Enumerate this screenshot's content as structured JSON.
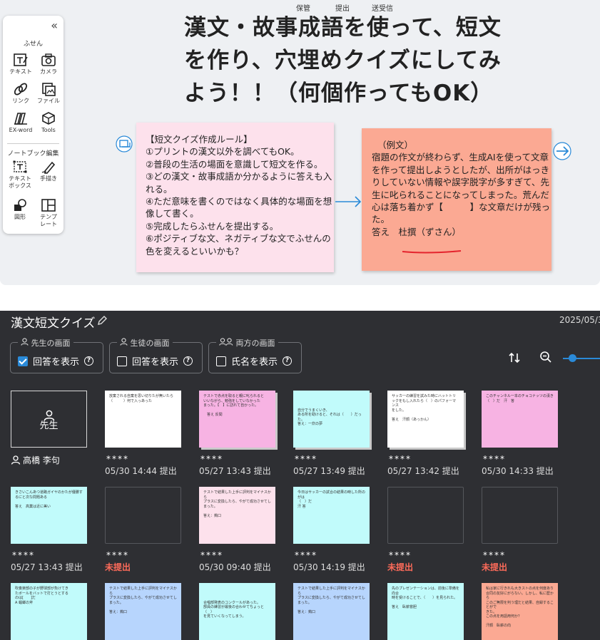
{
  "top_labels": [
    "保管",
    "提出",
    "送受信"
  ],
  "toolbar": {
    "section1": "ふせん",
    "section2": "ノートブック編集",
    "tools1": [
      {
        "label": "テキスト",
        "icon": "text-note-icon"
      },
      {
        "label": "カメラ",
        "icon": "camera-icon"
      },
      {
        "label": "リンク",
        "icon": "link-icon"
      },
      {
        "label": "ファイル",
        "icon": "file-icon"
      },
      {
        "label": "EX-word",
        "icon": "ex-word-icon"
      },
      {
        "label": "Tools",
        "icon": "tools-icon"
      }
    ],
    "tools2": [
      {
        "label": "テキスト\nボックス",
        "icon": "text-box-icon"
      },
      {
        "label": "手描き",
        "icon": "pen-icon"
      },
      {
        "label": "図形",
        "icon": "shape-icon"
      },
      {
        "label": "テンプ\nレート",
        "icon": "template-icon"
      }
    ]
  },
  "board": {
    "title": "漢文・故事成語を使って、短文を作り、穴埋めクイズにしてみよう！！（何個作ってもOK）",
    "rules_note": "【短文クイズ作成ルール】\n①プリントの漢文以外を調べてもOK。\n②普段の生活の場面を意識して短文を作る。\n③どの漢文・故事成語か分かるように答えも入れる。\n④ただ意味を書くのではなく具体的な場面を想像して書く。\n⑤完成したらふせんを提出する。\n⑥ポジティブな文、ネガティブな文でふせんの色を変えるといいかも？",
    "example_head": "（例文）",
    "example_body": "宿題の作文が終わらず、生成AIを使って文章を作って提出しようとしたが、出所がはっきりしていない情報や誤字脱字が多すぎて、先生に叱られることになってしまった。荒んだ心は落ち着かず【　　　】な文章だけが残った。\n答え　杜撰（ずさん）"
  },
  "panel": {
    "title": "漢文短文クイズ",
    "date": "2025/05/3",
    "views": [
      {
        "legend": "先生の画面",
        "label": "回答を表示",
        "checked": true
      },
      {
        "legend": "生徒の画面",
        "label": "回答を表示",
        "checked": false
      },
      {
        "legend": "両方の画面",
        "label": "氏名を表示",
        "checked": false
      }
    ],
    "teacher": {
      "label": "先生",
      "name": "高橋 李句"
    },
    "cards": [
      {
        "color": "#ffffff",
        "stack": false,
        "text": "放棄される自棄を思い切りたが無いたら\n（　　　）何で入っあった",
        "masked": "****",
        "status": "05/30 14:44 提出",
        "missing": false
      },
      {
        "color": "#f7b3e3",
        "stack": true,
        "text": "テストで赤点を取ると親に叱られると\nいいながら、勉強をしていなかった\nまった。【　】に訪れて自かった。\n\n　答え 反間",
        "masked": "****",
        "status": "05/27 13:43 提出",
        "missing": false
      },
      {
        "color": "#c1fbfb",
        "stack": true,
        "text": "\n\n\n自分でうまくいき、\nある所を助けると、それは（　　）だった。\n答え：一炊の夢",
        "masked": "****",
        "status": "05/27 13:49 提出",
        "missing": false
      },
      {
        "color": "#ffffff",
        "stack": true,
        "text": "サッカーの練習を試みた時にハットトリ\nックをもし入れたら（　）のパフォーマンス\nをした。\n\n答え　汗顔（あっかん）",
        "masked": "****",
        "status": "05/27 13:42 提出",
        "missing": false
      },
      {
        "color": "#f7b3e3",
        "stack": false,
        "text": "このチャンネル一本のチョコナッツの漢き\n（　）だ　汗　答",
        "masked": "****",
        "status": "05/30 14:33 提出",
        "missing": false
      },
      {
        "color": "#c1fbfb",
        "stack": false,
        "text": "きさいこんあつ道路ガイヤのかたが優勝す\nるにと次な問題ある\n\n答え　高業は近に美い",
        "masked": "****",
        "status": "05/27 13:43 提出",
        "missing": false
      },
      {
        "color": "",
        "stack": false,
        "text": "",
        "masked": "****",
        "status": "未提出",
        "missing": true
      },
      {
        "color": "#fde1ec",
        "stack": false,
        "text": "テストで結果した上手に評判をマイナスから\nプラスに変換したら、やがて成功させてしまった。\n\n答え：鶏口",
        "masked": "****",
        "status": "05/30 09:40 提出",
        "missing": false
      },
      {
        "color": "#c1fbfb",
        "stack": false,
        "text": "今日はサッカーの試合の結果の時した所のがは\n（　）だ\n汗 答",
        "masked": "****",
        "status": "05/30 14:19 提出",
        "missing": false
      },
      {
        "color": "",
        "stack": false,
        "text": "",
        "masked": "****",
        "status": "未提出",
        "missing": true
      },
      {
        "color": "",
        "stack": false,
        "text": "",
        "masked": "****",
        "status": "未提出",
        "missing": true
      },
      {
        "color": "#c1fbfb",
        "stack": false,
        "text": "吹奏楽部の子が野球部が負けてき\nたボールをバットで打とうとする\nのは[　　]だ\nA 蟷螂の斧",
        "masked": "",
        "status": "",
        "missing": false
      },
      {
        "color": "#b7d5fd",
        "stack": false,
        "text": "テストで結果した上手に評判をマイナスから\nプラスに変換したら、やがて成功させてしまった。\n\n答え：鶏口",
        "masked": "",
        "status": "",
        "missing": false
      },
      {
        "color": "#c1fbfb",
        "stack": false,
        "text": "\n\n\n合唱部発表のコンクールがあった。\n部員の練習が最後の合わせてちょっと（　）\nを見ていくなってしまう。",
        "masked": "",
        "status": "",
        "missing": false
      },
      {
        "color": "#b7d5fd",
        "stack": false,
        "text": "テストで結果した上手に評判をマイナスから\nプラスに変換したら、やがて成功させてしまった。\n\n答え：鶏口",
        "masked": "",
        "status": "",
        "missing": false
      },
      {
        "color": "#c1fbfb",
        "stack": false,
        "text": "先のプレゼンテーションは、前後に準備を向合\n時を受けることで、（　　）を見られた。\n\n答え　臥薪嘗胆",
        "masked": "",
        "status": "",
        "missing": false
      },
      {
        "color": "#fba993",
        "stack": false,
        "text": "私は家に行きれも大きストの点を何度あり\n合同の友好にがらない。しかし、私に歴から\nこのご無限を判う理だと結果、自録することがで\nきた。\nこの点を用語用何か？\n\n汗顔　臥薪の向",
        "masked": "",
        "status": "",
        "missing": false
      }
    ]
  }
}
